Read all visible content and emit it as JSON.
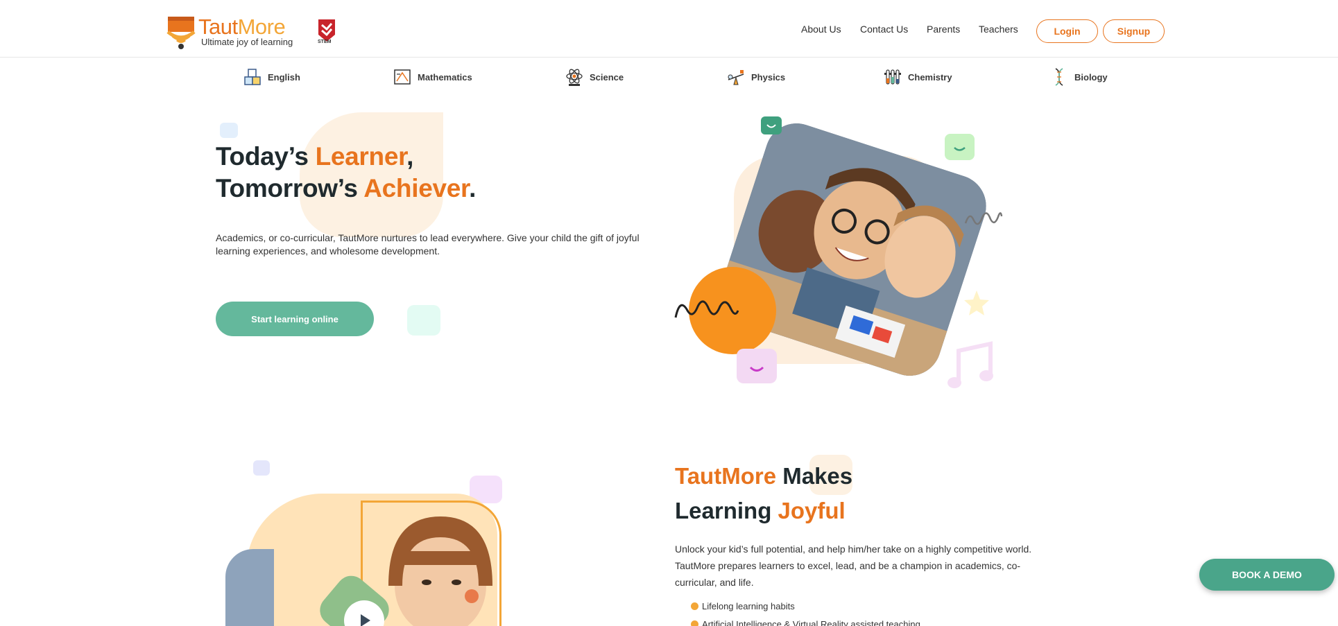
{
  "brand": {
    "name_part1": "Taut",
    "name_part2": "More",
    "tagline": "Ultimate joy of learning",
    "badge_label": "STEM",
    "accent": "#e8741e",
    "accent_light": "#f3a637",
    "green": "#64b89c"
  },
  "nav": {
    "links": [
      "About Us",
      "Contact Us",
      "Parents",
      "Teachers"
    ],
    "login": "Login",
    "signup": "Signup"
  },
  "subjects": [
    {
      "label": "English",
      "icon": "abc-blocks-icon"
    },
    {
      "label": "Mathematics",
      "icon": "math-board-icon"
    },
    {
      "label": "Science",
      "icon": "atom-icon"
    },
    {
      "label": "Physics",
      "icon": "seesaw-icon"
    },
    {
      "label": "Chemistry",
      "icon": "test-tubes-icon"
    },
    {
      "label": "Biology",
      "icon": "dna-icon"
    }
  ],
  "hero": {
    "line1_a": "Today’s ",
    "line1_b": "Learner",
    "line1_c": ",",
    "line2_a": "Tomorrow’s ",
    "line2_b": "Achiever",
    "line2_c": ".",
    "description": "Academics, or co-curricular, TautMore nurtures to lead everywhere. Give your child the gift of joyful learning experiences, and wholesome development.",
    "cta": "Start learning online"
  },
  "section2": {
    "title_a": "TautMore",
    "title_b": " Makes",
    "title_c": "Learning ",
    "title_d": "Joyful",
    "description": "Unlock your kid’s full potential, and help him/her take on a highly competitive world. TautMore prepares learners to excel, lead, and be a champion in academics, co-curricular, and life.",
    "bullets": [
      "Lifelong learning habits",
      "Artificial Intelligence & Virtual Reality assisted teaching"
    ]
  },
  "floating": {
    "book_demo": "BOOK A DEMO"
  }
}
